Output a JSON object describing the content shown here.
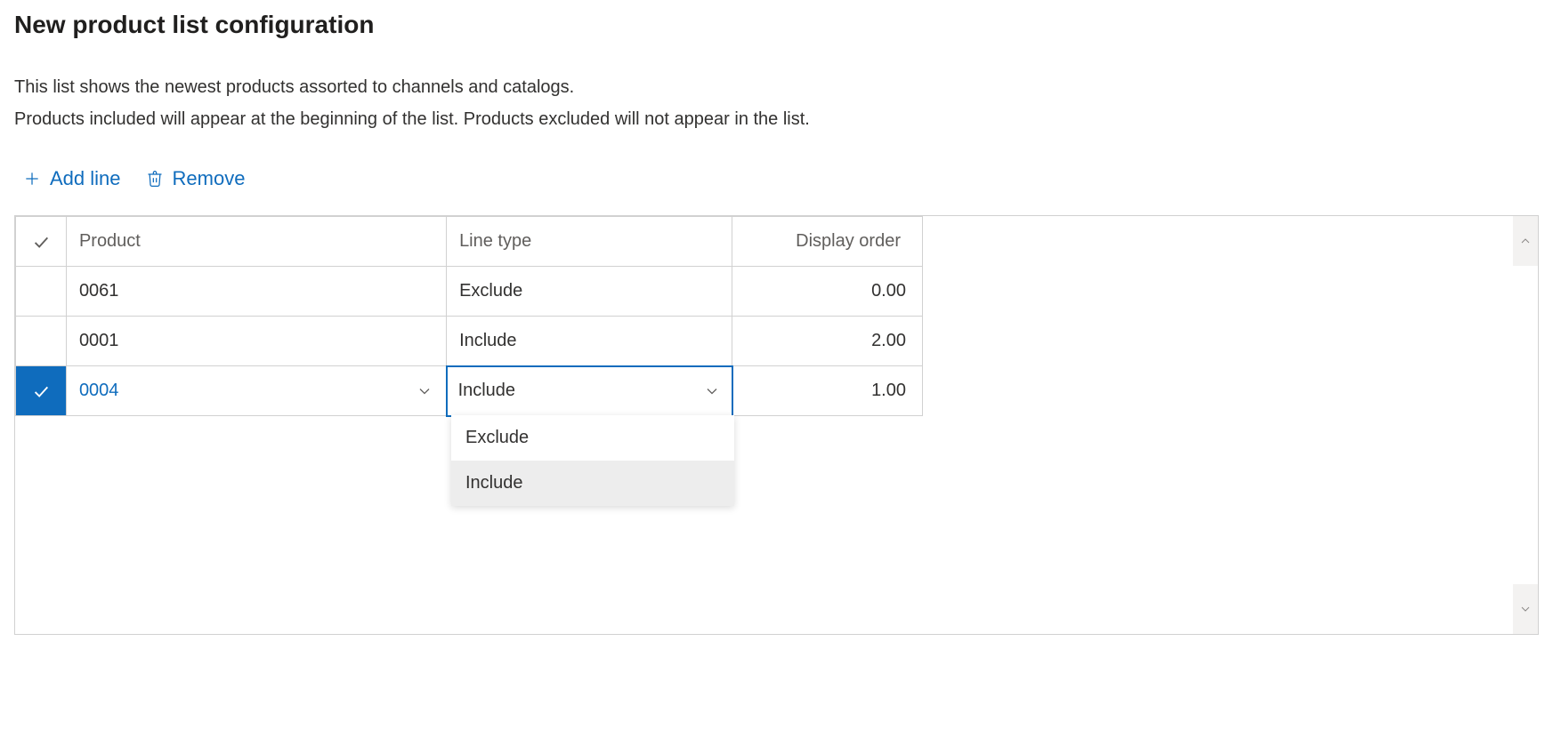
{
  "page": {
    "title": "New product list configuration",
    "description_line1": "This list shows the newest products assorted to channels and catalogs.",
    "description_line2": "Products included will appear at the beginning of the list. Products excluded will not appear in the list."
  },
  "toolbar": {
    "add_line_label": "Add line",
    "remove_label": "Remove"
  },
  "grid": {
    "columns": {
      "product": "Product",
      "line_type": "Line type",
      "display_order": "Display order"
    },
    "rows": [
      {
        "selected": false,
        "product": "0061",
        "line_type": "Exclude",
        "display_order": "0.00"
      },
      {
        "selected": false,
        "product": "0001",
        "line_type": "Include",
        "display_order": "2.00"
      },
      {
        "selected": true,
        "product": "0004",
        "line_type": "Include",
        "display_order": "1.00"
      }
    ]
  },
  "dropdown": {
    "options": [
      "Exclude",
      "Include"
    ],
    "highlighted": "Include"
  }
}
